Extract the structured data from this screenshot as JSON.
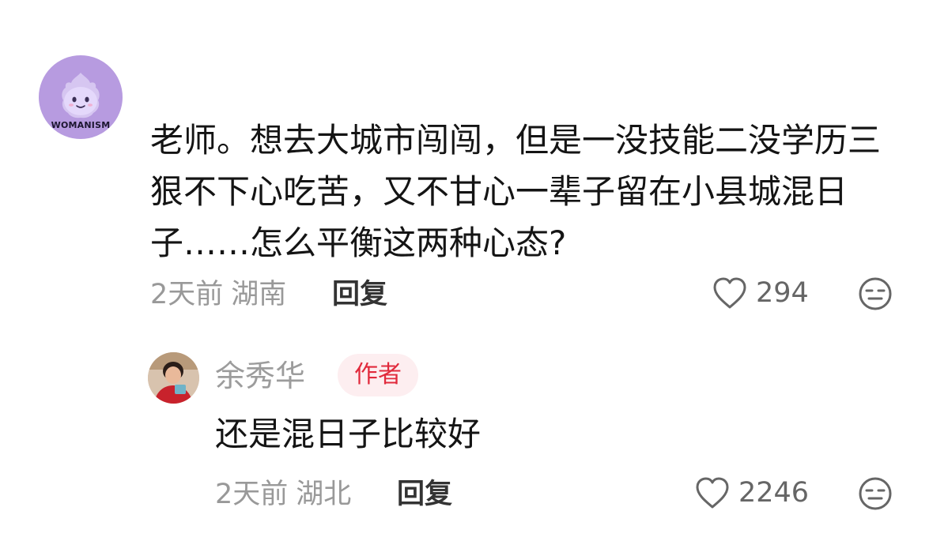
{
  "comment": {
    "avatar_text": "WOMANISM",
    "text": "老师。想去大城市闯闯，但是一没技能二没学历三狠不下心吃苦，又不甘心一辈子留在小县城混日子……怎么平衡这两种心态?",
    "time": "2天前",
    "location": "湖南",
    "reply_label": "回复",
    "likes": "294"
  },
  "reply": {
    "username": "余秀华",
    "badge": "作者",
    "text": "还是混日子比较好",
    "time": "2天前",
    "location": "湖北",
    "reply_label": "回复",
    "likes": "2246"
  },
  "icons": {
    "like": "heart-outline-icon",
    "dislike": "neutral-face-icon"
  },
  "colors": {
    "author_badge_text": "#e12a3c",
    "author_badge_bg": "#fdeef0",
    "meta_text": "#999999",
    "avatar_bg": "#b79be0"
  }
}
